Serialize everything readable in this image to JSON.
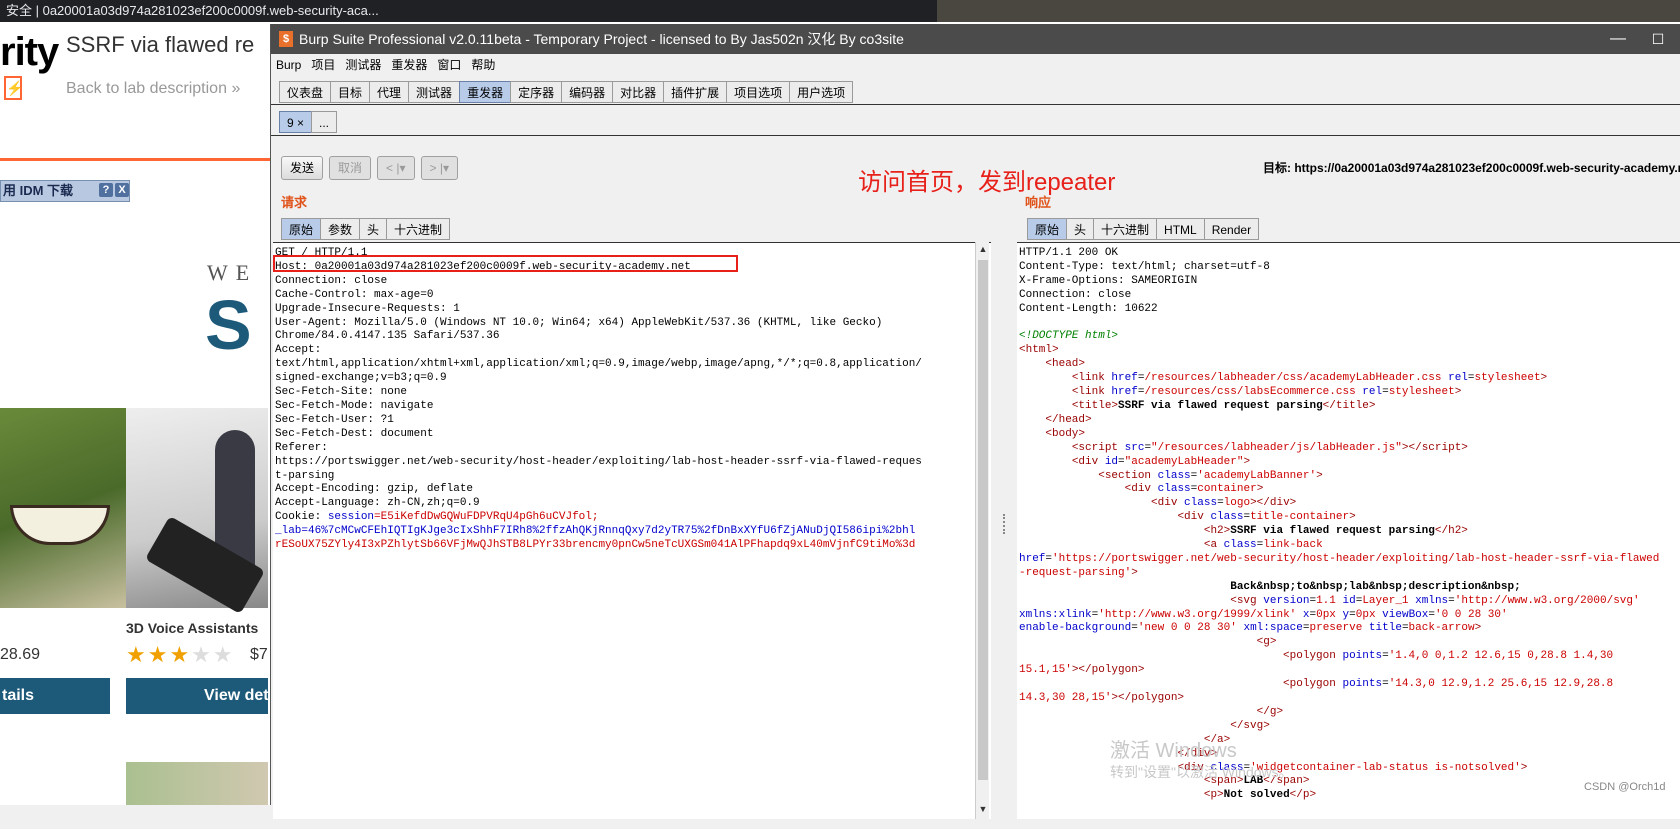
{
  "browser": {
    "tab_title": "安全 | 0a20001a03d974a281023ef200c0009f.web-security-aca...",
    "logo_text": "rity",
    "lab_title": "SSRF via flawed re",
    "back_link": "Back to lab description",
    "idm_label": "用 IDM 下载",
    "idm_help": "?",
    "idm_close": "X",
    "we_text": "WE",
    "big_letter": "S",
    "product_title": "3D Voice Assistants",
    "price1": "28.69",
    "price2": "$7",
    "stars": "★★★",
    "stars_off": "★★",
    "details_btn1": "tails",
    "details_btn2": "View det"
  },
  "burp": {
    "window_title": "Burp Suite Professional v2.0.11beta - Temporary Project - licensed to By Jas502n 汉化 By co3site",
    "icon": "$",
    "minimize": "—",
    "maximize": "☐",
    "menu": [
      "Burp",
      "项目",
      "测试器",
      "重发器",
      "窗口",
      "帮助"
    ],
    "tabs": [
      "仪表盘",
      "目标",
      "代理",
      "测试器",
      "重发器",
      "定序器",
      "编码器",
      "对比器",
      "插件扩展",
      "项目选项",
      "用户选项"
    ],
    "active_tab": "重发器",
    "sub_tabs": [
      "9 ×",
      "..."
    ],
    "toolbar": {
      "send": "发送",
      "cancel": "取消",
      "back": "< |▾",
      "forward": "> |▾"
    },
    "annotation": "访问首页，发到repeater",
    "target": "目标: https://0a20001a03d974a281023ef200c0009f.web-security-academy.net",
    "request_label": "请求",
    "response_label": "响应",
    "request_tabs": [
      "原始",
      "参数",
      "头",
      "十六进制"
    ],
    "response_tabs": [
      "原始",
      "头",
      "十六进制",
      "HTML",
      "Render"
    ],
    "request_lines": [
      "GET / HTTP/1.1",
      "Host: 0a20001a03d974a281023ef200c0009f.web-security-academy.net",
      "Connection: close",
      "Cache-Control: max-age=0",
      "Upgrade-Insecure-Requests: 1",
      "User-Agent: Mozilla/5.0 (Windows NT 10.0; Win64; x64) AppleWebKit/537.36 (KHTML, like Gecko)",
      "Chrome/84.0.4147.135 Safari/537.36",
      "Accept:",
      "text/html,application/xhtml+xml,application/xml;q=0.9,image/webp,image/apng,*/*;q=0.8,application/",
      "signed-exchange;v=b3;q=0.9",
      "Sec-Fetch-Site: none",
      "Sec-Fetch-Mode: navigate",
      "Sec-Fetch-User: ?1",
      "Sec-Fetch-Dest: document",
      "Referer:",
      "https://portswigger.net/web-security/host-header/exploiting/lab-host-header-ssrf-via-flawed-reques",
      "t-parsing",
      "Accept-Encoding: gzip, deflate",
      "Accept-Language: zh-CN,zh;q=0.9"
    ],
    "cookie_prefix": "Cookie: ",
    "cookie_name": "session",
    "cookie_line1": "=E5iKefdDwGQWuFDPVRqU4pGh6uCVJfol;",
    "cookie_line2": "_lab=46%7cMCwCFEhIQTIgKJge3cIxShhF7IRh8%2ffzAhQKjRnnqQxy7d2yTR75%2fDnBxXYfU6fZjANuDjQI586ipi%2bhl",
    "cookie_line3": "rESoUX75ZYly4I3xPZhlytSb66VFjMwQJhSTB8LPYr33brencmy0pnCw5neTcUXGSm041AlPFhapdq9xL40mVjnfC9tiMo%3d",
    "response_headers": [
      "HTTP/1.1 200 OK",
      "Content-Type: text/html; charset=utf-8",
      "X-Frame-Options: SAMEORIGIN",
      "Connection: close",
      "Content-Length: 10622"
    ],
    "html_title": "SSRF via flawed request parsing",
    "html_back": "Back&nbsp;to&nbsp;lab&nbsp;description&nbsp;",
    "lab_label": "LAB",
    "not_solved": "Not solved"
  },
  "overlay": {
    "watermark1": "激活 Windows",
    "watermark2": "转到\"设置\"以激活 Windows。",
    "csdn": "CSDN @Orch1d"
  }
}
